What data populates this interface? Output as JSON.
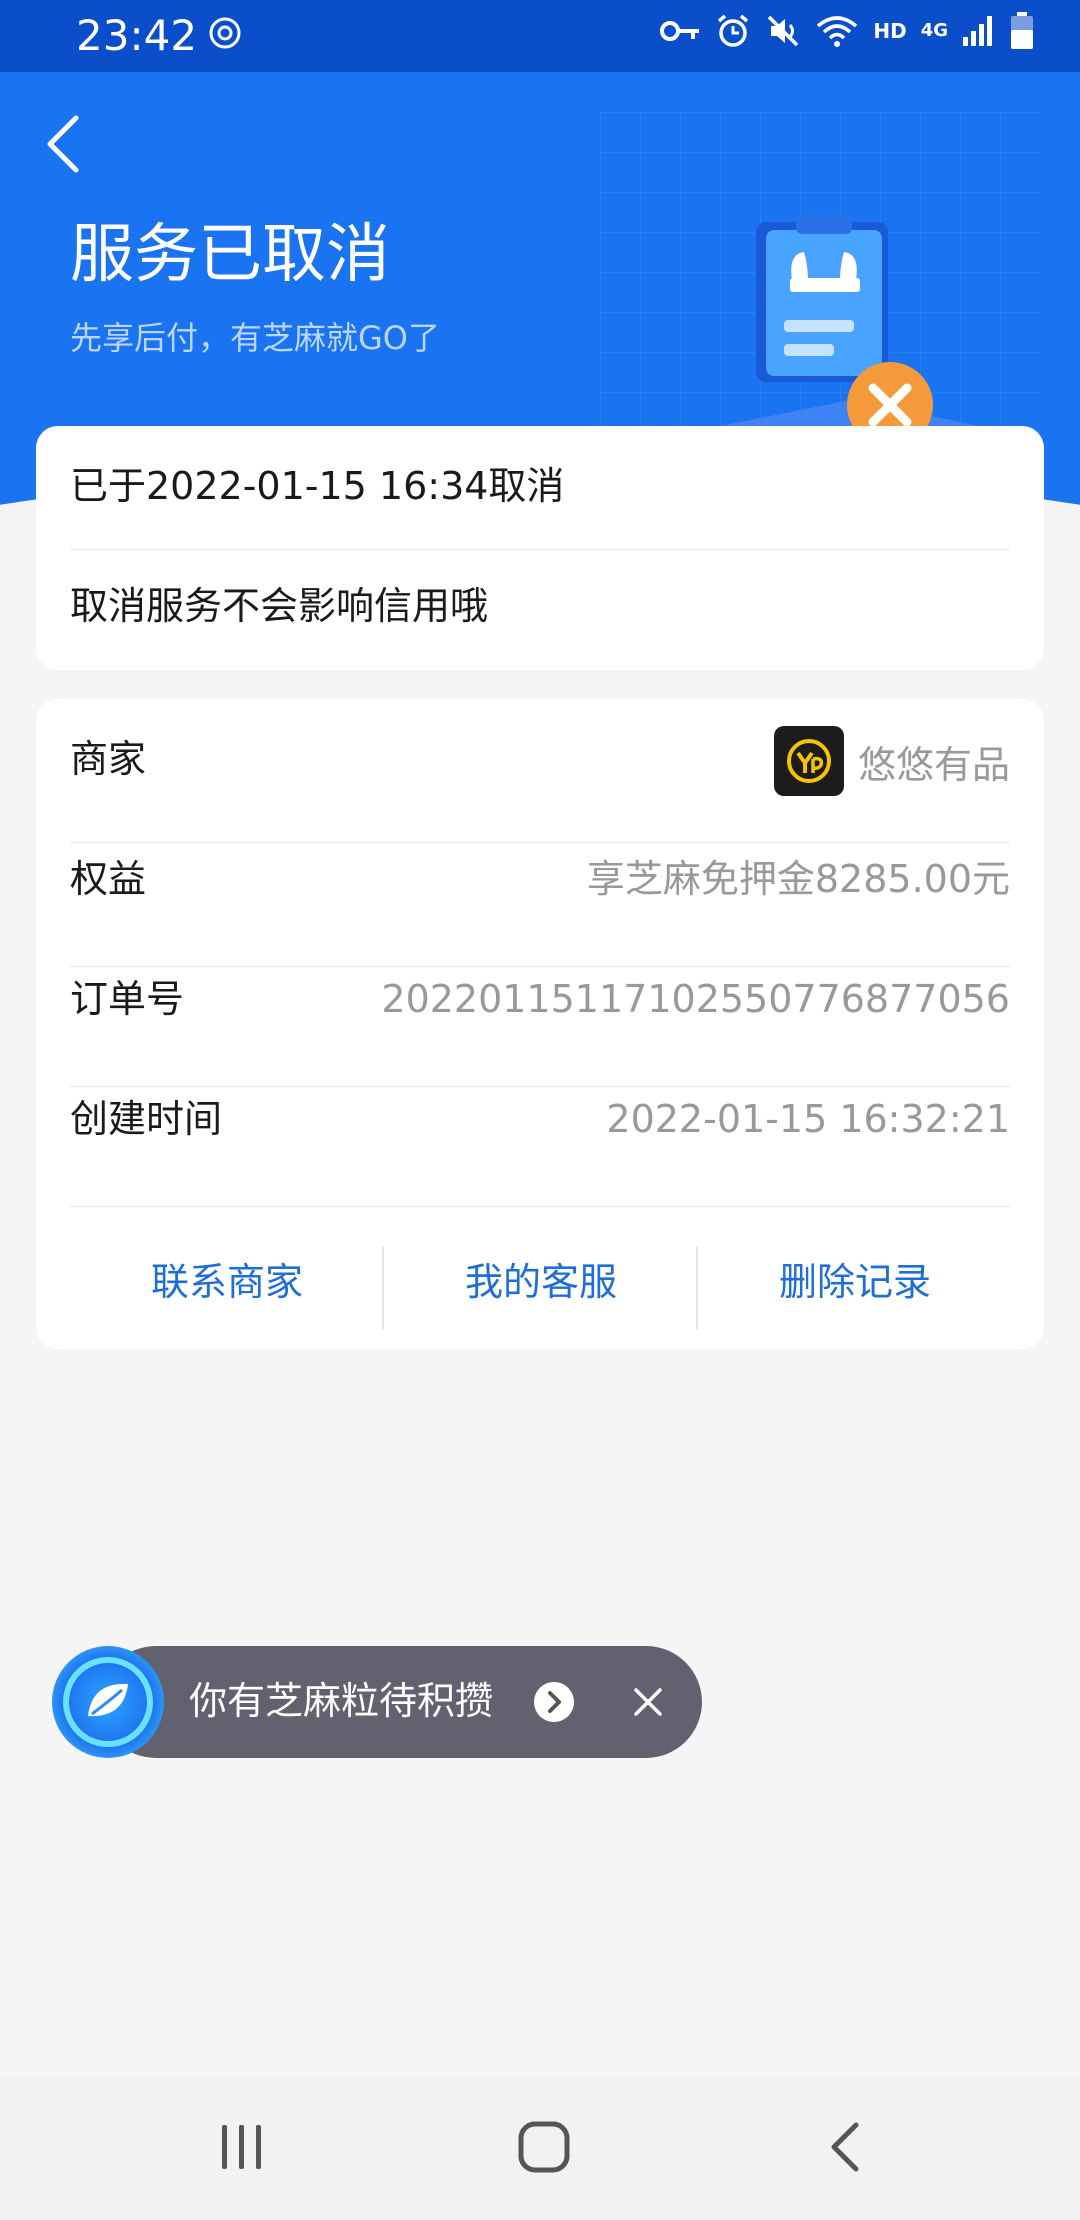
{
  "status_bar": {
    "time": "23:42",
    "network_label": "HD",
    "cell_label": "4G",
    "icons": [
      "location-ring-icon",
      "key-icon",
      "alarm-icon",
      "mute-icon",
      "wifi-icon",
      "signal-icon",
      "battery-icon"
    ]
  },
  "header": {
    "title": "服务已取消",
    "subtitle": "先享后付，有芝麻就GO了",
    "background_color": "#1a73f0"
  },
  "cancel_card": {
    "cancel_time": "已于2022-01-15 16:34取消",
    "note": "取消服务不会影响信用哦"
  },
  "details": {
    "rows": [
      {
        "label": "商家",
        "value": "悠悠有品"
      },
      {
        "label": "权益",
        "value": "享芝麻免押金8285.00元"
      },
      {
        "label": "订单号",
        "value": "2022011511710255077687705​6"
      },
      {
        "label": "创建时间",
        "value": "2022-01-15 16:32:21"
      }
    ],
    "actions": [
      "联系商家",
      "我的客服",
      "删除记录"
    ],
    "action_color": "#1e6ed8"
  },
  "toast": {
    "text": "你有芝麻粒待积攒"
  }
}
